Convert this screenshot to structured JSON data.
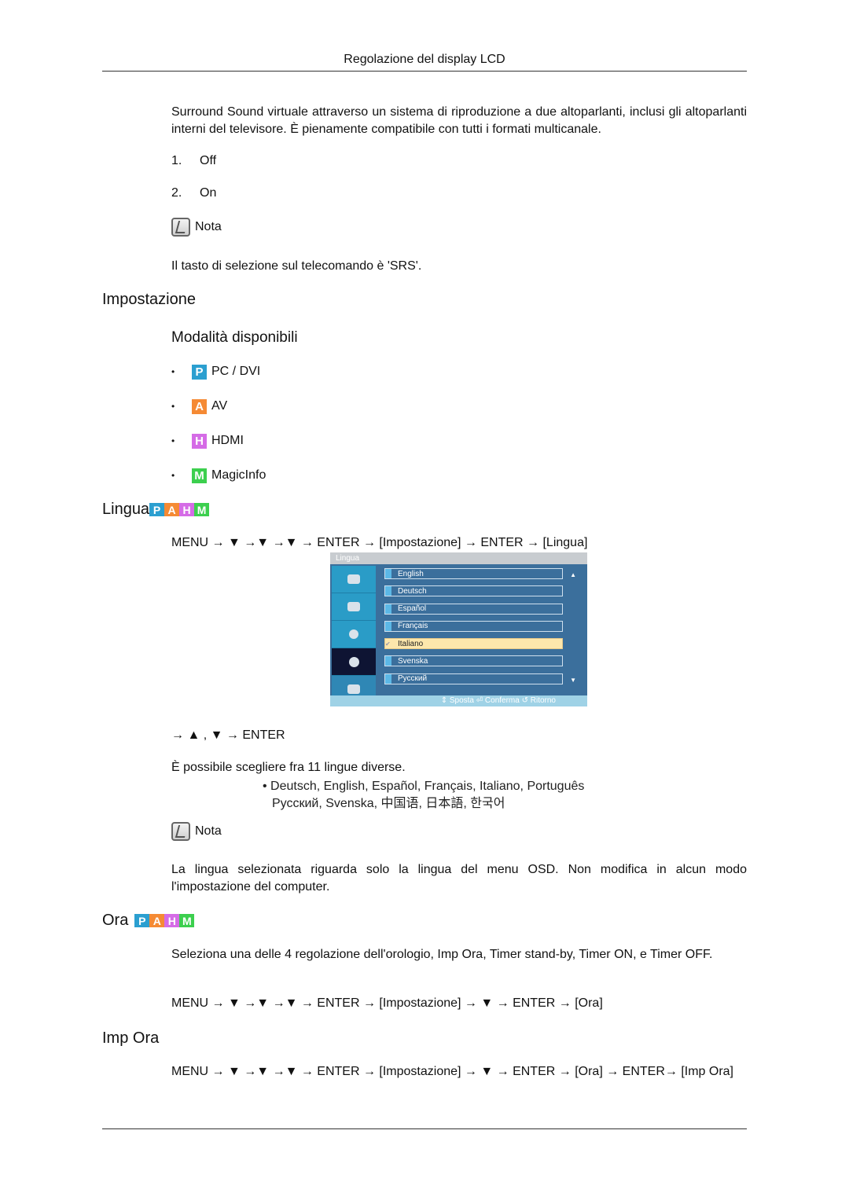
{
  "header": {
    "title": "Regolazione del display LCD"
  },
  "intro": {
    "text": "Surround Sound virtuale attraverso un sistema di riproduzione a due altoparlanti, inclusi gli altoparlanti interni del televisore. È pienamente compatibile con tutti i formati multicanale."
  },
  "options": [
    {
      "num": "1.",
      "label": "Off"
    },
    {
      "num": "2.",
      "label": "On"
    }
  ],
  "note1": {
    "label": "Nota",
    "text": "Il tasto di selezione sul telecomando è 'SRS'."
  },
  "impostazione": {
    "heading": "Impostazione",
    "subheading": "Modalità disponibili",
    "modes": [
      {
        "badge": "P",
        "label": "PC / DVI",
        "color": "#2b9fd0"
      },
      {
        "badge": "A",
        "label": "AV",
        "color": "#f58a34"
      },
      {
        "badge": "H",
        "label": "HDMI",
        "color": "#d56be6"
      },
      {
        "badge": "M",
        "label": "MagicInfo",
        "color": "#3ccf4e"
      }
    ]
  },
  "lingua": {
    "heading": "Lingua",
    "badges": [
      "P",
      "A",
      "H",
      "M"
    ],
    "path": "MENU → ▼ →▼ →▼ → ENTER → [Impostazione] → ENTER → [Lingua]",
    "osd": {
      "title": "Lingua",
      "items": [
        "English",
        "Deutsch",
        "Español",
        "Français",
        "Italiano",
        "Svenska",
        "Русский"
      ],
      "selected": "Italiano",
      "footer": "⇕ Sposta  ⏎ Conferma  ↺ Ritorno"
    },
    "nav": "→ ▲ , ▼ → ENTER",
    "info": "È possibile scegliere fra 11 lingue diverse.",
    "languages_line1": "• Deutsch, English, Español, Français, Italiano, Português",
    "languages_line2": "Русский, Svenska, 中国语, 日本語, 한국어",
    "note": {
      "label": "Nota",
      "text": "La lingua selezionata riguarda solo la lingua del menu OSD. Non modifica in alcun modo l'impostazione del computer."
    }
  },
  "ora": {
    "heading": "Ora",
    "text_prefix": "Seleziona una delle 4 regolazione dell'orologio, ",
    "opt1": "Imp Ora",
    "opt2": "Timer stand-by",
    "opt3": "Timer ON",
    "opt4": "Timer OFF",
    "sep": ", ",
    "and": ", e ",
    "path": "MENU → ▼ →▼ →▼ → ENTER → [Impostazione] → ▼ → ENTER → [Ora]"
  },
  "imp_ora": {
    "heading": "Imp Ora",
    "path": "MENU → ▼ →▼ →▼ → ENTER → [Impostazione] → ▼ → ENTER → [Ora] → ENTER→ [Imp Ora]"
  }
}
